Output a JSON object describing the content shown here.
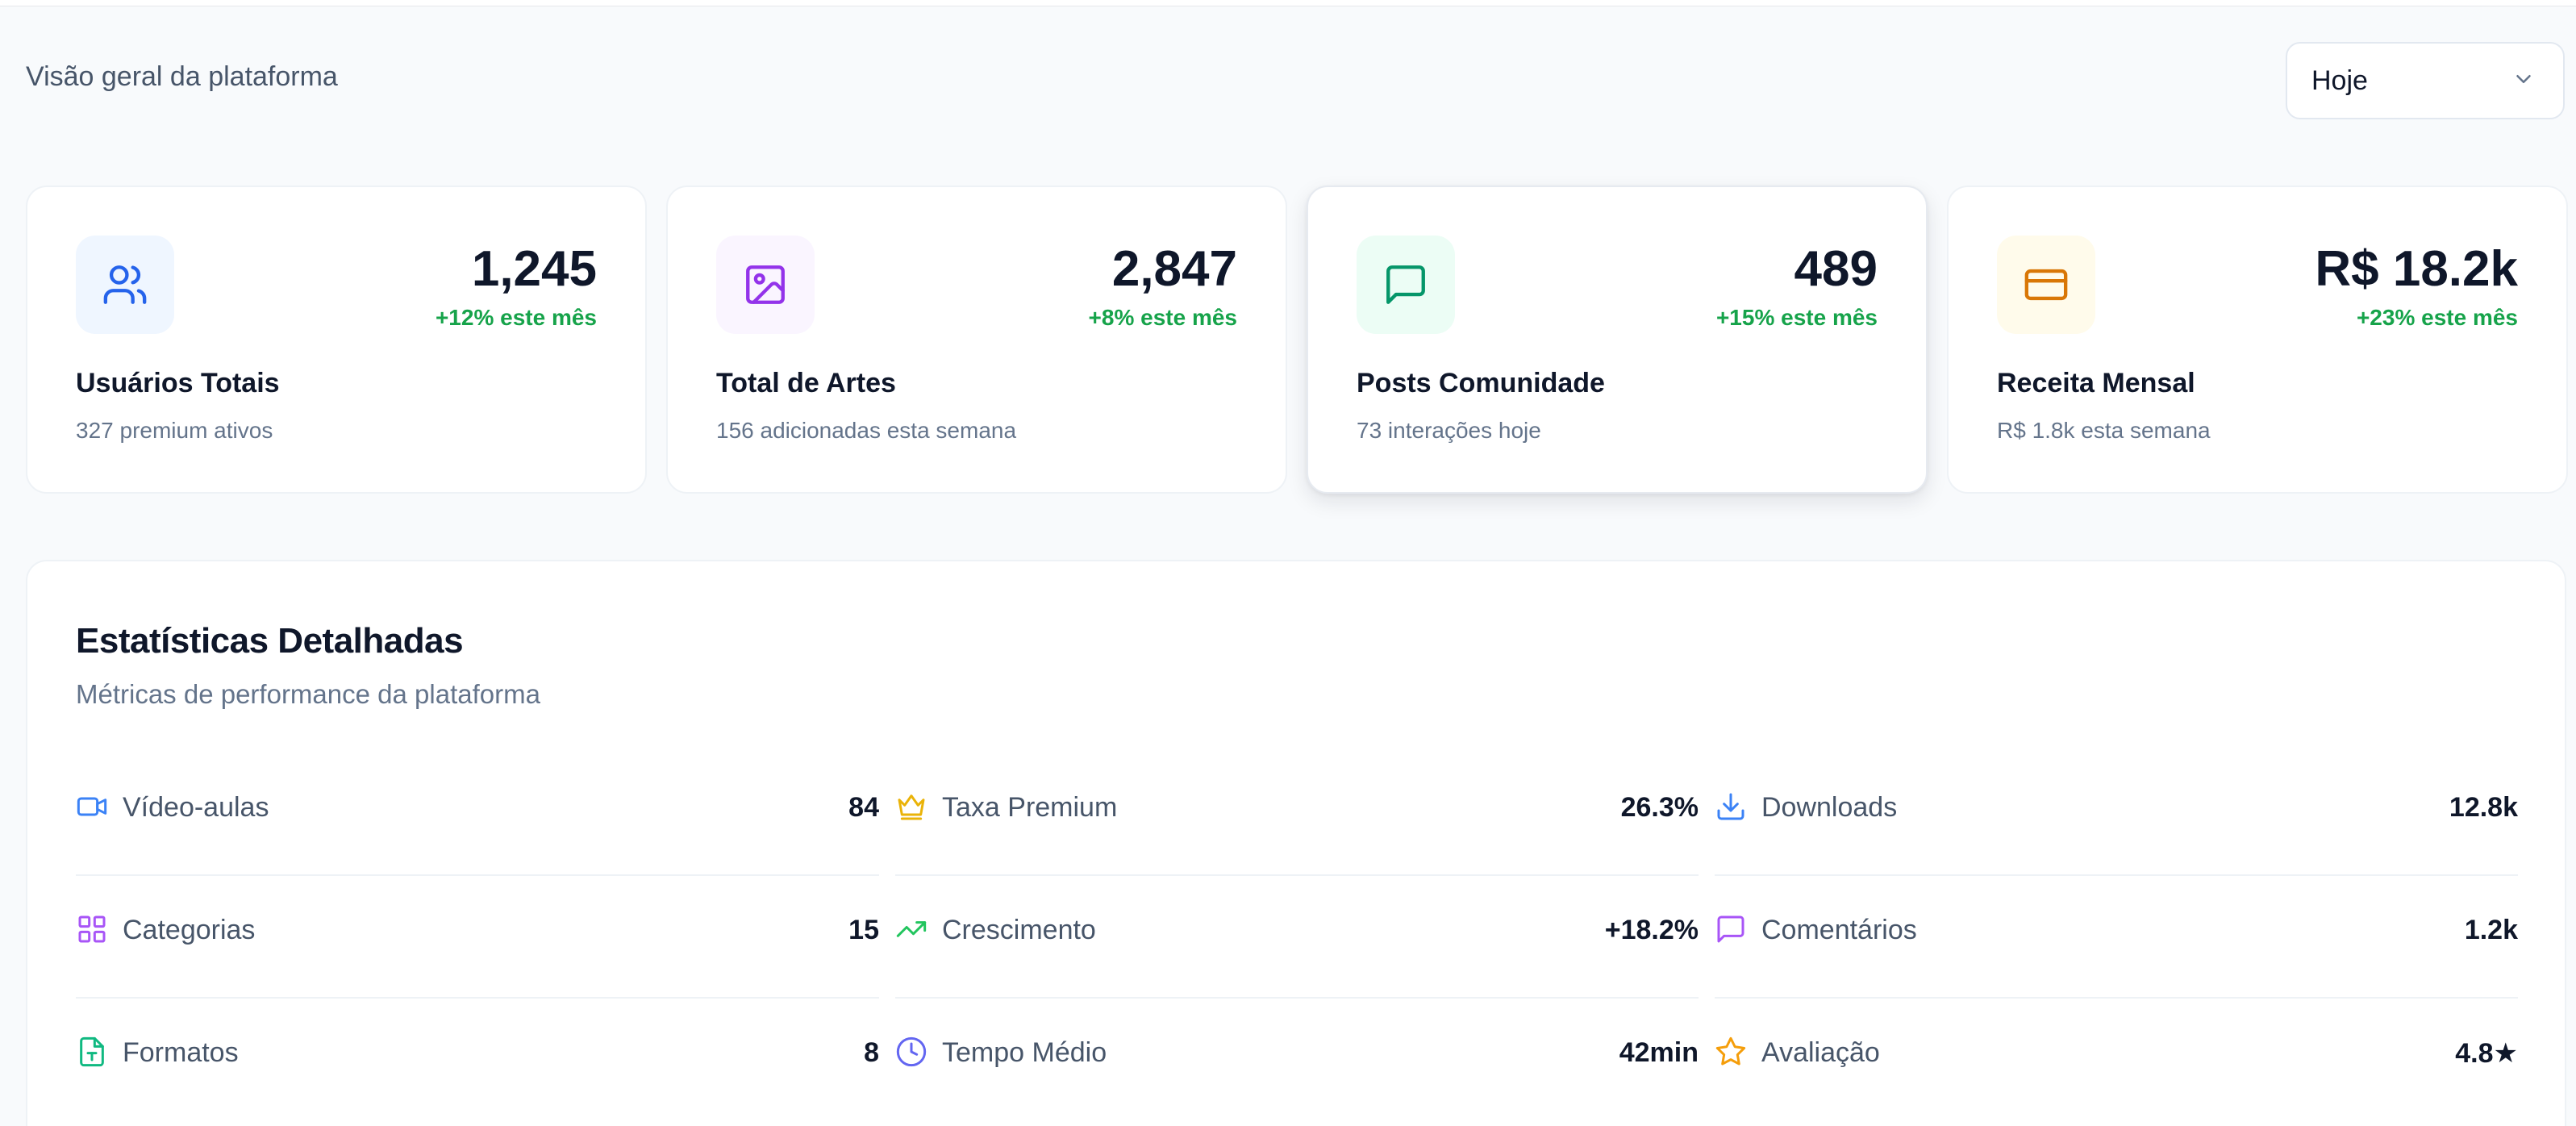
{
  "header": {
    "subtitle": "Visão geral da plataforma",
    "period_select": {
      "value": "Hoje"
    }
  },
  "cards": [
    {
      "icon": "users-icon",
      "icon_color": "#2563eb",
      "icon_bg": "#eff6ff",
      "value": "1,245",
      "change": "+12% este mês",
      "title": "Usuários Totais",
      "subtitle": "327 premium ativos"
    },
    {
      "icon": "image-icon",
      "icon_color": "#9333ea",
      "icon_bg": "#faf5ff",
      "value": "2,847",
      "change": "+8% este mês",
      "title": "Total de Artes",
      "subtitle": "156 adicionadas esta semana"
    },
    {
      "icon": "message-square-icon",
      "icon_color": "#059669",
      "icon_bg": "#ecfdf5",
      "value": "489",
      "change": "+15% este mês",
      "title": "Posts Comunidade",
      "subtitle": "73 interações hoje"
    },
    {
      "icon": "credit-card-icon",
      "icon_color": "#d97706",
      "icon_bg": "#fffbeb",
      "value": "R$ 18.2k",
      "change": "+23% este mês",
      "title": "Receita Mensal",
      "subtitle": "R$ 1.8k esta semana"
    }
  ],
  "stats_panel": {
    "title": "Estatísticas Detalhadas",
    "subtitle": "Métricas de performance da plataforma",
    "items": [
      {
        "icon": "video-icon",
        "color": "#3b82f6",
        "label": "Vídeo-aulas",
        "value": "84"
      },
      {
        "icon": "crown-icon",
        "color": "#eab308",
        "label": "Taxa Premium",
        "value": "26.3%"
      },
      {
        "icon": "download-icon",
        "color": "#3b82f6",
        "label": "Downloads",
        "value": "12.8k"
      },
      {
        "icon": "grid-icon",
        "color": "#a855f7",
        "label": "Categorias",
        "value": "15"
      },
      {
        "icon": "trending-up-icon",
        "color": "#22c55e",
        "label": "Crescimento",
        "value": "+18.2%"
      },
      {
        "icon": "message-square-icon",
        "color": "#a855f7",
        "label": "Comentários",
        "value": "1.2k"
      },
      {
        "icon": "file-type-icon",
        "color": "#10b981",
        "label": "Formatos",
        "value": "8"
      },
      {
        "icon": "clock-icon",
        "color": "#6366f1",
        "label": "Tempo Médio",
        "value": "42min"
      },
      {
        "icon": "star-icon",
        "color": "#f59e0b",
        "label": "Avaliação",
        "value": "4.8★"
      }
    ]
  },
  "accent_color": "#16a34a"
}
